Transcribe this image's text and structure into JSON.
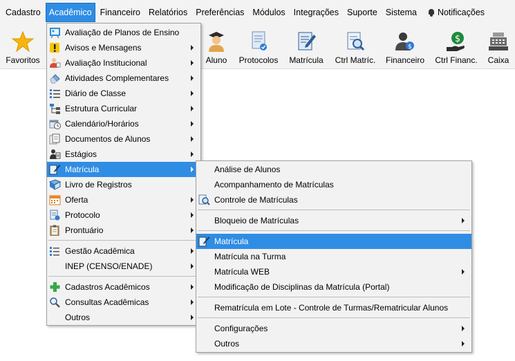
{
  "menubar": {
    "items": [
      "Cadastro",
      "Acadêmico",
      "Financeiro",
      "Relatórios",
      "Preferências",
      "Módulos",
      "Integrações",
      "Suporte",
      "Sistema"
    ],
    "active_index": 1,
    "notifications_label": "Notificações"
  },
  "toolbar": {
    "favoritos": "Favoritos",
    "aluno": "Aluno",
    "protocolos": "Protocolos",
    "matricula": "Matrícula",
    "ctrl_matric": "Ctrl Matríc.",
    "financeiro": "Financeiro",
    "ctrl_financ": "Ctrl Financ.",
    "caixa": "Caixa"
  },
  "academico_menu": {
    "items": [
      {
        "label": "Avaliação de Planos de Ensino",
        "icon": "plan-evaluation-icon",
        "submenu": false
      },
      {
        "label": "Avisos e Mensagens",
        "icon": "warning-icon",
        "submenu": true
      },
      {
        "label": "Avaliação Institucional",
        "icon": "evaluation-person-icon",
        "submenu": true
      },
      {
        "label": "Atividades Complementares",
        "icon": "eraser-icon",
        "submenu": true
      },
      {
        "label": "Diário de Classe",
        "icon": "list-icon",
        "submenu": true
      },
      {
        "label": "Estrutura Curricular",
        "icon": "hierarchy-icon",
        "submenu": true
      },
      {
        "label": "Calendário/Horários",
        "icon": "calendar-clock-icon",
        "submenu": true
      },
      {
        "label": "Documentos de Alunos",
        "icon": "documents-icon",
        "submenu": true
      },
      {
        "label": "Estágios",
        "icon": "intern-icon",
        "submenu": true
      },
      {
        "label": "Matrícula",
        "icon": "enrollment-pen-icon",
        "submenu": true,
        "highlighted": true
      },
      {
        "label": "Livro de Registros",
        "icon": "book-icon",
        "submenu": false
      },
      {
        "label": "Oferta",
        "icon": "calendar-icon",
        "submenu": true
      },
      {
        "label": "Protocolo",
        "icon": "protocol-icon",
        "submenu": true
      },
      {
        "label": "Prontuário",
        "icon": "clipboard-icon",
        "submenu": true
      },
      {
        "label": "Gestão Acadêmica",
        "icon": "management-icon",
        "submenu": true
      },
      {
        "label": "INEP (CENSO/ENADE)",
        "icon": "",
        "submenu": true
      },
      {
        "label": "Cadastros Acadêmicos",
        "icon": "plus-icon",
        "submenu": true
      },
      {
        "label": "Consultas Acadêmicas",
        "icon": "magnifier-icon",
        "submenu": true
      },
      {
        "label": "Outros",
        "icon": "",
        "submenu": true
      }
    ]
  },
  "matricula_submenu": {
    "items": [
      {
        "label": "Análise de Alunos",
        "submenu": false
      },
      {
        "label": "Acompanhamento de Matrículas",
        "submenu": false
      },
      {
        "label": "Controle de Matrículas",
        "icon": "control-search-icon",
        "submenu": false
      },
      {
        "label": "Bloqueio de Matrículas",
        "submenu": true
      },
      {
        "label": "Matrícula",
        "icon": "enrollment-pen-icon",
        "submenu": false,
        "highlighted": true
      },
      {
        "label": "Matrícula na Turma",
        "submenu": false
      },
      {
        "label": "Matrícula WEB",
        "submenu": true
      },
      {
        "label": "Modificação de Disciplinas da Matrícula (Portal)",
        "submenu": false
      },
      {
        "label": "Rematrícula em Lote - Controle de Turmas/Rematricular Alunos",
        "submenu": false
      },
      {
        "label": "Configurações",
        "submenu": true
      },
      {
        "label": "Outros",
        "submenu": true
      }
    ]
  },
  "colors": {
    "highlight": "#2f8de4",
    "menu_bg": "#f2f2f2",
    "toolbar_bg": "#f3f3f3"
  }
}
